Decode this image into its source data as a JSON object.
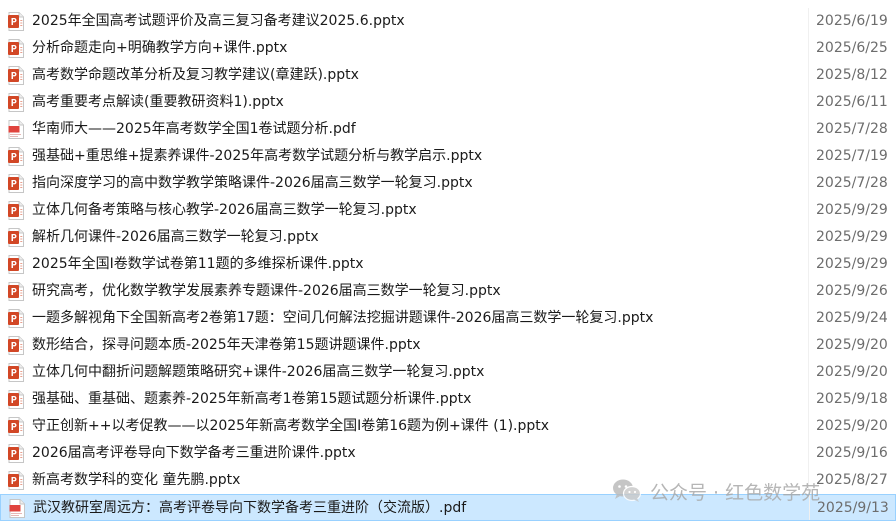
{
  "files": [
    {
      "name": "2025年全国高考试题评价及高三复习备考建议2025.6.pptx",
      "date": "2025/6/19",
      "icon": "pptx-icon"
    },
    {
      "name": "分析命题走向+明确教学方向+课件.pptx",
      "date": "2025/6/25",
      "icon": "pptx-icon"
    },
    {
      "name": "高考数学命题改革分析及复习教学建议(章建跃).pptx",
      "date": "2025/8/12",
      "icon": "pptx-icon"
    },
    {
      "name": "高考重要考点解读(重要教研资料1).pptx",
      "date": "2025/6/11",
      "icon": "pptx-icon"
    },
    {
      "name": "华南师大——2025年高考数学全国1卷试题分析.pdf",
      "date": "2025/7/28",
      "icon": "pdf-icon"
    },
    {
      "name": "强基础+重思维+提素养课件-2025年高考数学试题分析与教学启示.pptx",
      "date": "2025/7/19",
      "icon": "pptx-icon"
    },
    {
      "name": "指向深度学习的高中数学教学策略课件-2026届高三数学一轮复习.pptx",
      "date": "2025/7/28",
      "icon": "pptx-icon"
    },
    {
      "name": "立体几何备考策略与核心教学-2026届高三数学一轮复习.pptx",
      "date": "2025/9/29",
      "icon": "pptx-icon"
    },
    {
      "name": "解析几何课件-2026届高三数学一轮复习.pptx",
      "date": "2025/9/29",
      "icon": "pptx-icon"
    },
    {
      "name": "2025年全国Ⅰ卷数学试卷第11题的多维探析课件.pptx",
      "date": "2025/9/29",
      "icon": "pptx-icon"
    },
    {
      "name": "研究高考，优化数学教学发展素养专题课件-2026届高三数学一轮复习.pptx",
      "date": "2025/9/26",
      "icon": "pptx-icon"
    },
    {
      "name": "一题多解视角下全国新高考2卷第17题：空间几何解法挖掘讲题课件-2026届高三数学一轮复习.pptx",
      "date": "2025/9/24",
      "icon": "pptx-icon"
    },
    {
      "name": "数形结合，探寻问题本质-2025年天津卷第15题讲题课件.pptx",
      "date": "2025/9/20",
      "icon": "pptx-icon"
    },
    {
      "name": "立体几何中翻折问题解题策略研究+课件-2026届高三数学一轮复习.pptx",
      "date": "2025/9/20",
      "icon": "pptx-icon"
    },
    {
      "name": "强基础、重基础、题素养-2025年新高考1卷第15题试题分析课件.pptx",
      "date": "2025/9/18",
      "icon": "pptx-icon"
    },
    {
      "name": "守正创新++以考促教——以2025年新高考数学全国Ⅰ卷第16题为例+课件 (1).pptx",
      "date": "2025/9/20",
      "icon": "pptx-icon"
    },
    {
      "name": "2026届高考评卷导向下数学备考三重进阶课件.pptx",
      "date": "2025/9/16",
      "icon": "pptx-icon"
    },
    {
      "name": "新高考数学科的变化 童先鹏.pptx",
      "date": "2025/8/27",
      "icon": "pptx-icon"
    },
    {
      "name": "武汉教研室周远方：高考评卷导向下数学备考三重进阶（交流版）.pdf",
      "date": "2025/9/13",
      "icon": "pdf-icon",
      "selected": true
    }
  ],
  "watermark": {
    "text": "公众号 · 红色数学苑",
    "icon": "wechat-icon"
  },
  "colors": {
    "pptx": "#d24726",
    "pdf": "#e0443e",
    "selected_bg": "#cce8ff",
    "selected_border": "#99d1ff"
  }
}
